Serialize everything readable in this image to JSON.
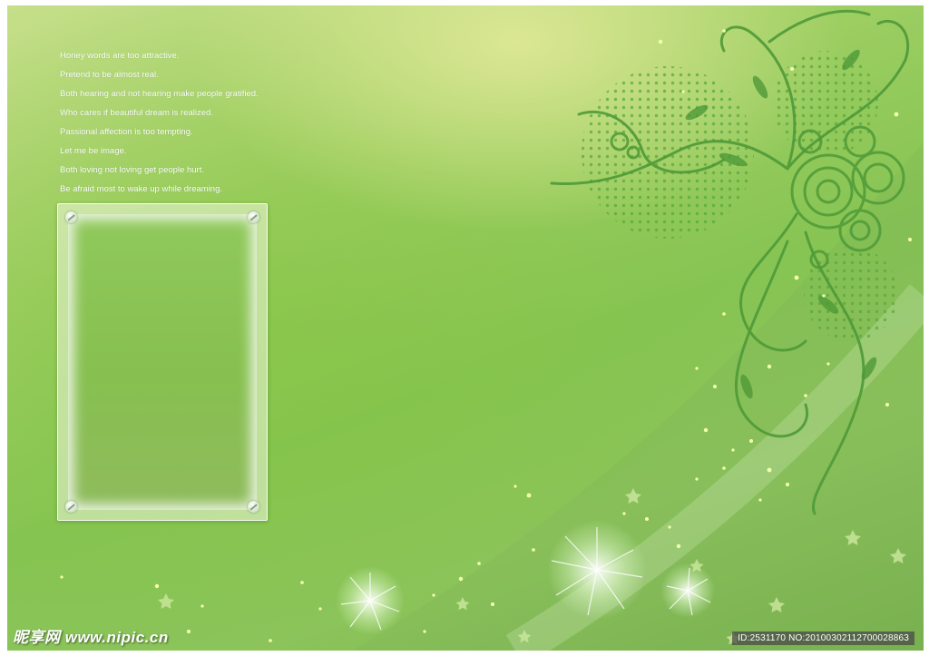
{
  "poem": {
    "lines": [
      "Honey words are too attractive.",
      "Pretend to be almost real.",
      "Both hearing and not hearing make people gratified.",
      "Who cares if beautiful dream is realized.",
      "Passional affection is too tempting.",
      "Let me be image.",
      "Both loving not loving get people hurt.",
      "Be afraid most to wake up while dreaming."
    ]
  },
  "watermark": {
    "logo_text": "昵享网 www.nipic.cn",
    "id_text": "ID:2531170 NO:20100302112700028863"
  },
  "colors": {
    "swirl": "#4f9a38",
    "dots": "#5aa83e",
    "sparkle": "#f4ffb0",
    "star": "#c8e69a",
    "flower": "#eaffd8"
  },
  "icons": [
    "screw-icon",
    "flourish-icon",
    "sparkle-icon",
    "star-icon",
    "flower-icon"
  ]
}
